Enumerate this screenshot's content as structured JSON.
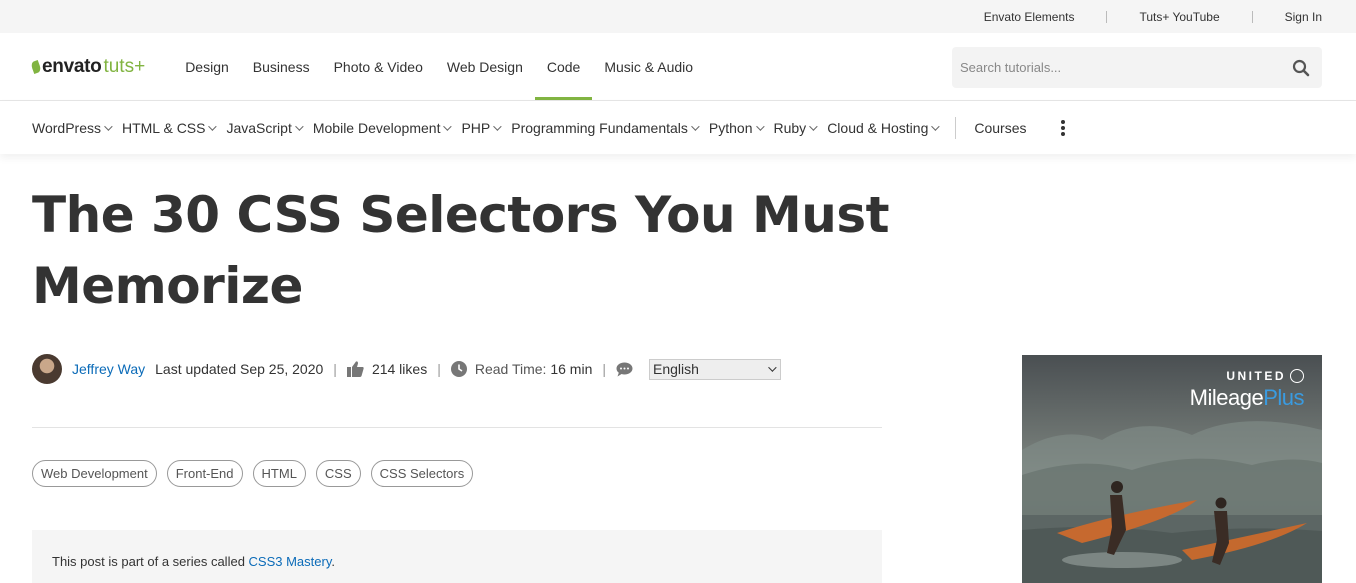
{
  "topbar": {
    "links": [
      "Envato Elements",
      "Tuts+ YouTube",
      "Sign In"
    ]
  },
  "logo": {
    "envato": "envato",
    "tuts": "tuts+"
  },
  "mainnav": {
    "items": [
      "Design",
      "Business",
      "Photo & Video",
      "Web Design",
      "Code",
      "Music & Audio"
    ],
    "active": "Code"
  },
  "search": {
    "placeholder": "Search tutorials..."
  },
  "subnav": {
    "items": [
      "WordPress",
      "HTML & CSS",
      "JavaScript",
      "Mobile Development",
      "PHP",
      "Programming Fundamentals",
      "Python",
      "Ruby",
      "Cloud & Hosting"
    ],
    "courses": "Courses"
  },
  "article": {
    "title": "The 30 CSS Selectors You Must Memorize",
    "author": "Jeffrey Way",
    "updated": "Last updated Sep 25, 2020",
    "likes": "214 likes",
    "read_label": "Read Time:",
    "read_time": "16 min",
    "language": "English",
    "tags": [
      "Web Development",
      "Front-End",
      "HTML",
      "CSS",
      "CSS Selectors"
    ],
    "series_prefix": "This post is part of a series called ",
    "series_name": "CSS3 Mastery",
    "series_suffix": "."
  },
  "ad": {
    "brand": "UNITED",
    "program_a": "Mileage",
    "program_b": "Plus"
  },
  "colors": {
    "accent": "#81b441",
    "link": "#0b6bb8"
  }
}
